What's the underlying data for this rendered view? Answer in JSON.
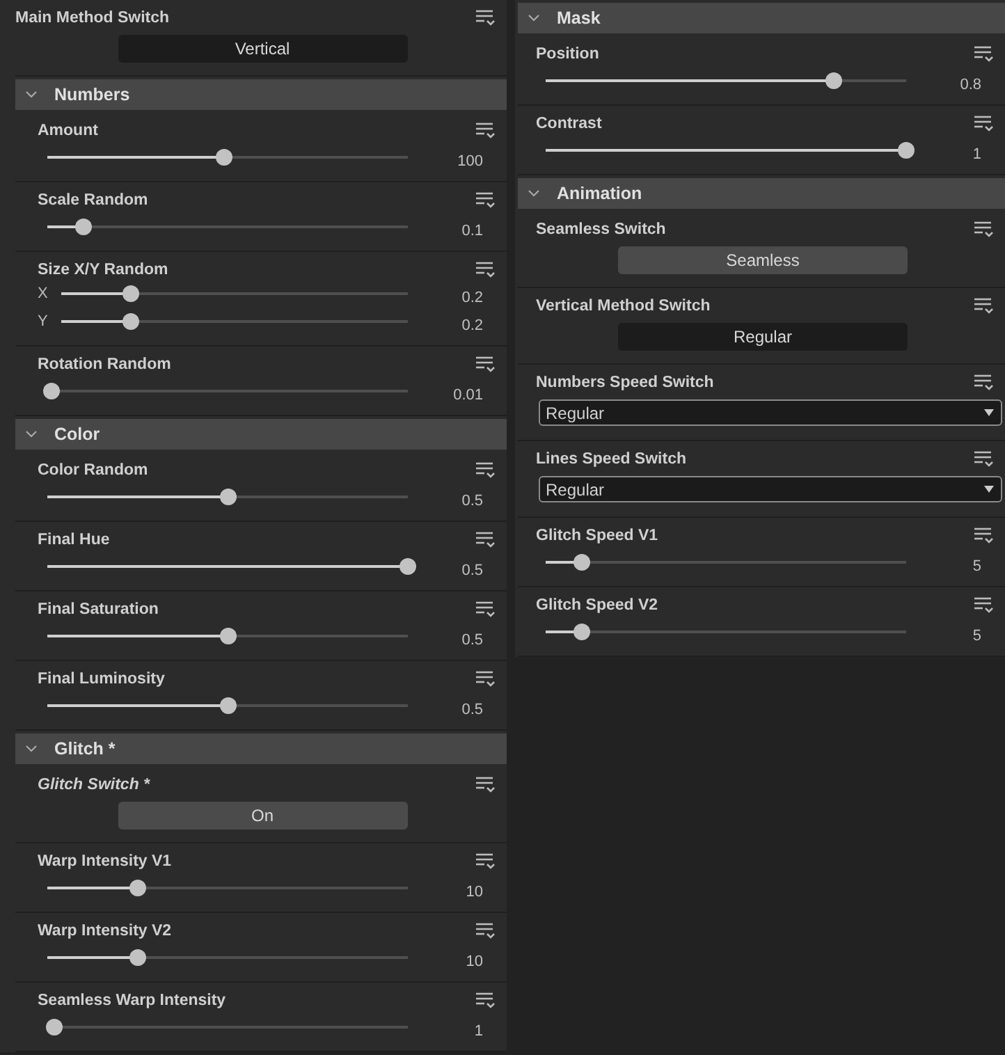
{
  "columns": [
    {
      "items": [
        {
          "kind": "button",
          "label": "Main Method Switch",
          "italic": false,
          "value": "Vertical",
          "pressed": false
        },
        {
          "kind": "section",
          "title": "Numbers",
          "expanded": true,
          "children": [
            {
              "kind": "slider",
              "label": "Amount",
              "italic": false,
              "level": 0.49,
              "reading": "100"
            },
            {
              "kind": "slider",
              "label": "Scale Random",
              "italic": false,
              "level": 0.1,
              "reading": "0.1"
            },
            {
              "kind": "slider_xy",
              "label": "Size X/Y Random",
              "italic": false,
              "axes": [
                {
                  "axis": "X",
                  "level": 0.2,
                  "reading": "0.2"
                },
                {
                  "axis": "Y",
                  "level": 0.2,
                  "reading": "0.2"
                }
              ]
            },
            {
              "kind": "slider",
              "label": "Rotation Random",
              "italic": false,
              "level": 0.01,
              "reading": "0.01"
            }
          ]
        },
        {
          "kind": "section",
          "title": "Color",
          "expanded": true,
          "children": [
            {
              "kind": "slider",
              "label": "Color Random",
              "italic": false,
              "level": 0.5,
              "reading": "0.5"
            },
            {
              "kind": "slider",
              "label": "Final Hue",
              "italic": false,
              "level": 1,
              "reading": "0.5"
            },
            {
              "kind": "slider",
              "label": "Final Saturation",
              "italic": false,
              "level": 0.5,
              "reading": "0.5"
            },
            {
              "kind": "slider",
              "label": "Final Luminosity",
              "italic": false,
              "level": 0.5,
              "reading": "0.5"
            }
          ]
        },
        {
          "kind": "section",
          "title": "Glitch *",
          "expanded": true,
          "children": [
            {
              "kind": "button",
              "label": "Glitch Switch *",
              "italic": true,
              "value": "On",
              "pressed": true
            },
            {
              "kind": "slider",
              "label": "Warp Intensity V1",
              "italic": false,
              "level": 0.25,
              "reading": "10"
            },
            {
              "kind": "slider",
              "label": "Warp Intensity V2",
              "italic": false,
              "level": 0.25,
              "reading": "10"
            },
            {
              "kind": "slider",
              "label": "Seamless Warp Intensity",
              "italic": false,
              "level": 0.02,
              "reading": "1"
            }
          ]
        }
      ]
    },
    {
      "items": [
        {
          "kind": "section",
          "title": "Mask",
          "expanded": true,
          "children": [
            {
              "kind": "slider",
              "label": "Position",
              "italic": false,
              "level": 0.8,
              "reading": "0.8"
            },
            {
              "kind": "slider",
              "label": "Contrast",
              "italic": false,
              "level": 1,
              "reading": "1"
            }
          ]
        },
        {
          "kind": "section",
          "title": "Animation",
          "expanded": true,
          "children": [
            {
              "kind": "button",
              "label": "Seamless Switch",
              "italic": false,
              "value": "Seamless",
              "pressed": true
            },
            {
              "kind": "button",
              "label": "Vertical Method Switch",
              "italic": false,
              "value": "Regular",
              "pressed": false
            },
            {
              "kind": "dropdown",
              "label": "Numbers Speed Switch",
              "italic": false,
              "value": "Regular"
            },
            {
              "kind": "dropdown",
              "label": "Lines Speed Switch",
              "italic": false,
              "value": "Regular"
            },
            {
              "kind": "slider",
              "label": "Glitch Speed V1",
              "italic": false,
              "level": 0.1,
              "reading": "5"
            },
            {
              "kind": "slider",
              "label": "Glitch Speed V2",
              "italic": false,
              "level": 0.1,
              "reading": "5"
            }
          ]
        }
      ]
    }
  ]
}
